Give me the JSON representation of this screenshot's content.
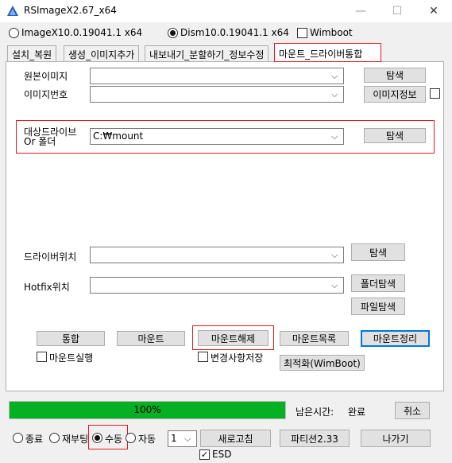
{
  "window": {
    "title": "RSImageX2.67_x64"
  },
  "mode": {
    "imagex_label": "ImageX10.0.19041.1 x64",
    "dism_label": "Dism10.0.19041.1 x64",
    "selected": "dism",
    "wimboot_label": "Wimboot",
    "wimboot_checked": false
  },
  "tabs": [
    {
      "label": "설치_복원",
      "active": false
    },
    {
      "label": "생성_이미지추가",
      "active": false
    },
    {
      "label": "내보내기_분할하기_정보수정",
      "active": false
    },
    {
      "label": "마운트_드라이버통합",
      "active": true
    }
  ],
  "mount_tab": {
    "source_image_label": "원본이미지",
    "source_image_value": "",
    "source_browse_label": "탐색",
    "image_index_label": "이미지번호",
    "image_index_value": "",
    "image_info_label": "이미지정보",
    "image_info_checked": false,
    "target_label_line1": "대상드라이브",
    "target_label_line2": "Or 폴더",
    "target_value": "C:₩mount",
    "target_browse_label": "탐색",
    "driver_label": "드라이버위치",
    "driver_value": "",
    "driver_browse_label": "탐색",
    "hotfix_label": "Hotfix위치",
    "hotfix_value": "",
    "folder_browse_label": "폴더탐색",
    "file_browse_label": "파일탐색",
    "buttons": {
      "integrate": "통합",
      "mount": "마운트",
      "unmount": "마운트해제",
      "mount_list": "마운트목록",
      "mount_cleanup": "마운트정리"
    },
    "run_after_mount_label": "마운트실행",
    "run_after_mount_checked": false,
    "save_changes_label": "변경사항저장",
    "save_changes_checked": false,
    "optimize_label": "최적화(WimBoot)"
  },
  "status": {
    "progress_percent": 100,
    "progress_text": "100%",
    "remaining_label": "남은시간:",
    "remaining_value": "완료",
    "cancel_label": "취소"
  },
  "bottom": {
    "after_options": [
      {
        "label": "종료",
        "selected": false
      },
      {
        "label": "재부팅",
        "selected": false
      },
      {
        "label": "수동",
        "selected": true
      },
      {
        "label": "자동",
        "selected": false
      }
    ],
    "count_value": "1",
    "refresh_label": "새로고침",
    "partition_label": "파티션2.33",
    "exit_label": "나가기",
    "esd_label": "ESD",
    "esd_checked": true
  },
  "colors": {
    "progress_fill": "#06b025",
    "highlight_border": "#e0191f",
    "focus_border": "#0078d7"
  }
}
